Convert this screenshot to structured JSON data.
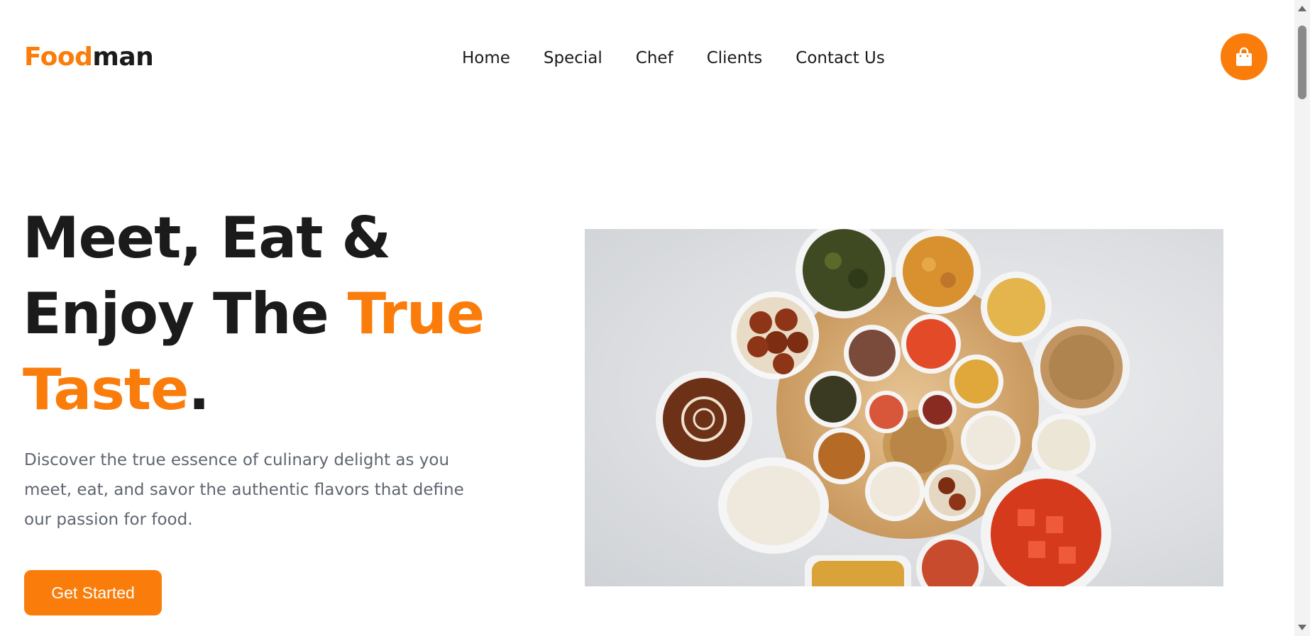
{
  "brand": {
    "name_accent": "Food",
    "name_rest": "man",
    "accent_color": "#fa7d0b",
    "text_color": "#1b1b1b"
  },
  "nav": {
    "links": [
      "Home",
      "Special",
      "Chef",
      "Clients",
      "Contact Us"
    ]
  },
  "cart": {
    "icon": "shopping-bag-icon"
  },
  "hero": {
    "title_line1": "Meet, Eat &",
    "title_line2_plain": "Enjoy The ",
    "title_line2_accent": "True",
    "title_line3_accent": "Taste",
    "title_line3_plain": ".",
    "description": "Discover the true essence of culinary delight as you meet, eat, and savor the authentic flavors that define our passion for food.",
    "cta_label": "Get Started",
    "image_subject": "thali-platter-image"
  }
}
